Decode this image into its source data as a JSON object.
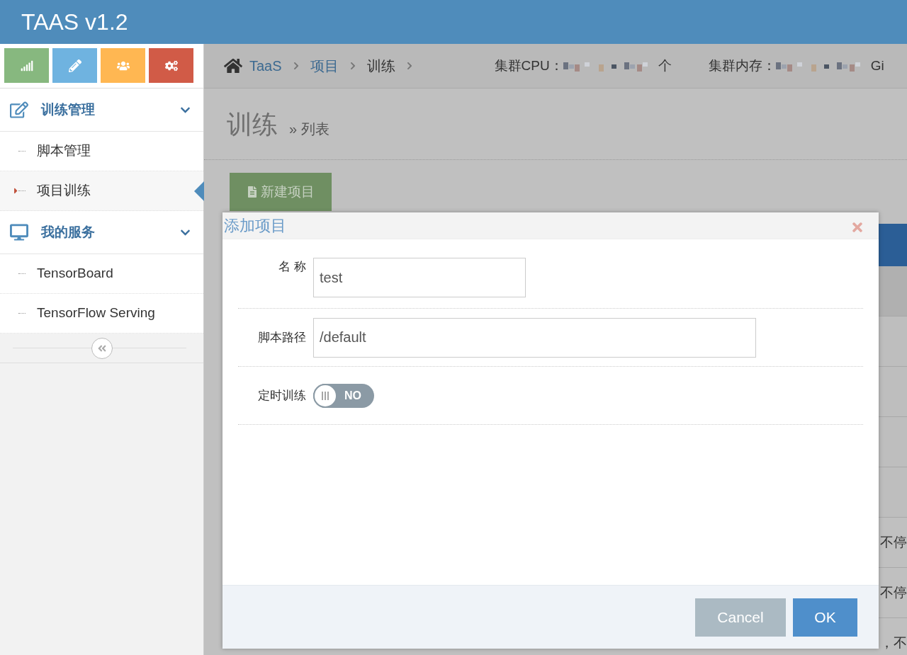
{
  "app": {
    "title": "TAAS v1.2"
  },
  "shortcuts": [
    {
      "kind": "signal",
      "color": "#87b87f"
    },
    {
      "kind": "pencil",
      "color": "#6fb3e0"
    },
    {
      "kind": "users",
      "color": "#ffb752"
    },
    {
      "kind": "cogs",
      "color": "#d15b47"
    }
  ],
  "sidebar": {
    "groups": [
      {
        "label": "训练管理",
        "kind": "edit",
        "expanded": true,
        "children": [
          {
            "label": "脚本管理",
            "selected": false
          },
          {
            "label": "项目训练",
            "selected": true
          }
        ]
      },
      {
        "label": "我的服务",
        "kind": "desktop",
        "expanded": true,
        "children": [
          {
            "label": "TensorBoard",
            "selected": false
          },
          {
            "label": "TensorFlow Serving",
            "selected": false
          }
        ]
      }
    ]
  },
  "breadcrumb": [
    {
      "label": "TaaS",
      "kind": "link"
    },
    {
      "label": "项目",
      "kind": "link"
    },
    {
      "label": "训练",
      "kind": "current"
    }
  ],
  "cluster": {
    "cpu_label": "集群CPU：",
    "cpu_unit": "个",
    "memory_label": "集群内存：",
    "memory_unit": "Gi"
  },
  "page": {
    "title": "训练",
    "subtitle": "» 列表",
    "new_button": "新建项目"
  },
  "table_behind": {
    "rows": [
      "不停",
      "不停",
      "，不"
    ]
  },
  "dialog": {
    "title": "添加项目",
    "fields": [
      {
        "kind": "short",
        "label": "名 称",
        "value": "test"
      },
      {
        "kind": "long",
        "label": "脚本路径",
        "value": "/default"
      },
      {
        "kind": "switch",
        "label": "定时训练",
        "on": false,
        "state_text": "NO"
      }
    ],
    "buttons": [
      {
        "label": "Cancel",
        "kind": "secondary"
      },
      {
        "label": "OK",
        "kind": "primary"
      }
    ]
  }
}
